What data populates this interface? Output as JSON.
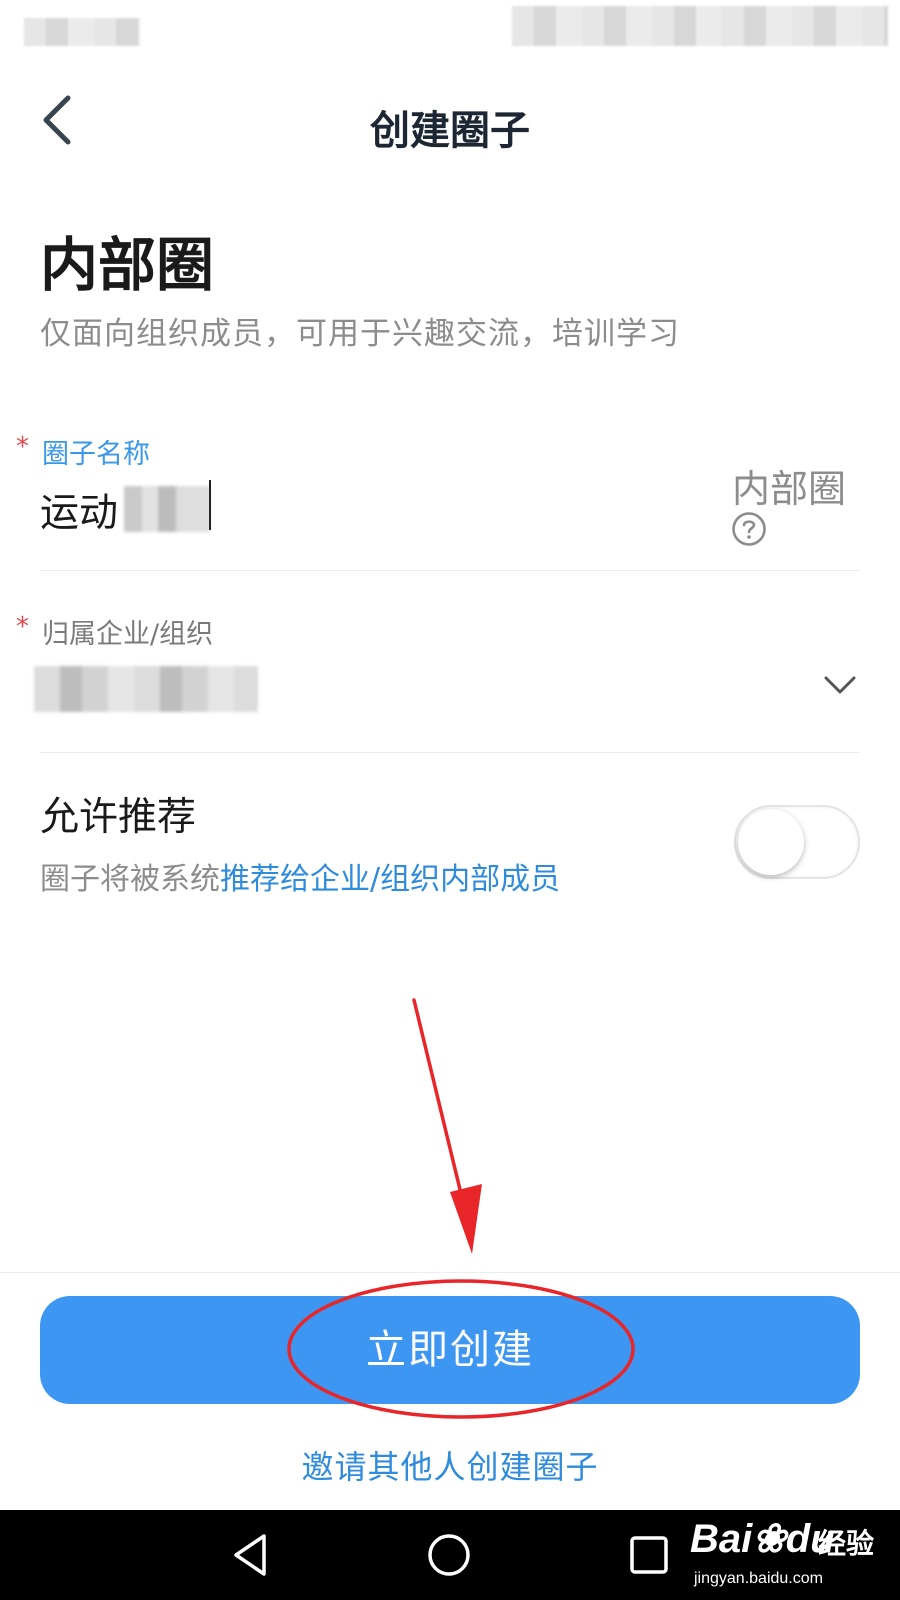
{
  "nav": {
    "title": "创建圈子",
    "back_icon": "chevron-left-icon"
  },
  "circle": {
    "type_title": "内部圈",
    "description": "仅面向组织成员，可用于兴趣交流，培训学习"
  },
  "form": {
    "required_mark": "*",
    "name_label": "圈子名称",
    "name_value": "运动",
    "name_type_tag": "内部圈",
    "help_icon": "question-circle-icon",
    "org_label": "归属企业/组织",
    "org_icon": "chevron-down-icon"
  },
  "recommend": {
    "title": "允许推荐",
    "desc_prefix": "圈子将被系统",
    "desc_highlight": "推荐给企业/组织内部成员",
    "enabled": false
  },
  "actions": {
    "create_label": "立即创建",
    "invite_label": "邀请其他人创建圈子"
  },
  "system_nav": {
    "back_icon": "triangle-back-icon",
    "home_icon": "circle-home-icon",
    "recent_icon": "square-recent-icon"
  },
  "watermark": {
    "brand": "Bai",
    "brand_suffix": "du",
    "cn": "经验",
    "url": "jingyan.baidu.com"
  },
  "colors": {
    "accent": "#3d97f2",
    "link": "#2f8bdc",
    "required": "#e5484d",
    "annotation": "#e8262a"
  }
}
